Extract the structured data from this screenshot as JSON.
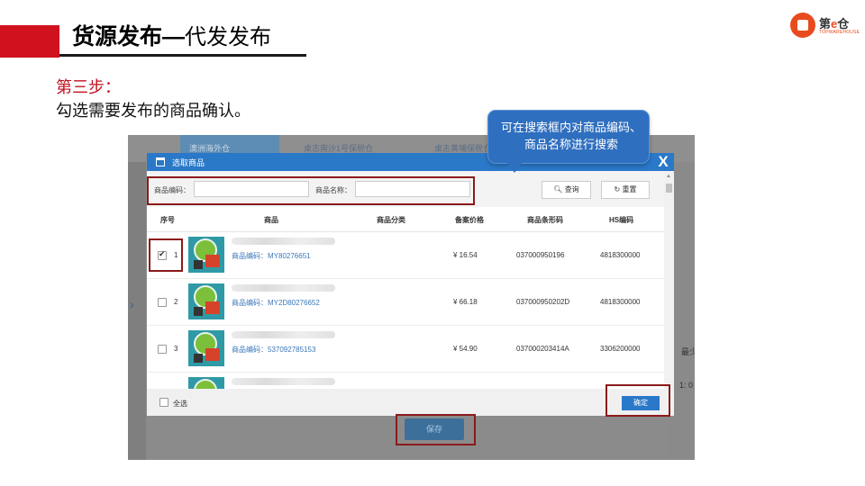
{
  "slide": {
    "title_main": "货源发布—",
    "title_sub": "代发发布",
    "step_label": "第三步：",
    "step_desc": "勾选需要发布的商品确认。",
    "tooltip": "可在搜索框内对商品编码、商品名称进行搜索"
  },
  "logo": {
    "prefix": "第",
    "e": "e",
    "suffix": "仓",
    "sub": "TOPWAREHOUSE"
  },
  "background": {
    "tabs": [
      "澳洲海外仓",
      "桌志南沙1号保税仓",
      "桌志黄埔保税仓"
    ],
    "right_labels": [
      "最少",
      "1: 0"
    ]
  },
  "modal": {
    "title": "选取商品",
    "close": "X",
    "search": {
      "code_label": "商品编码：",
      "code_value": "",
      "name_label": "商品名称：",
      "name_value": "",
      "query_button": "查询",
      "reset_button": "重置"
    },
    "columns": [
      "序号",
      "商品",
      "商品分类",
      "备案价格",
      "商品条形码",
      "HS编码"
    ],
    "rows": [
      {
        "index": "1",
        "checked": true,
        "code": "商品编码：MY80276651",
        "price": "¥ 16.54",
        "barcode": "037000950196",
        "hs": "4818300000"
      },
      {
        "index": "2",
        "checked": false,
        "code": "商品编码：MY2D80276652",
        "price": "¥ 66.18",
        "barcode": "037000950202D",
        "hs": "4818300000"
      },
      {
        "index": "3",
        "checked": false,
        "code": "商品编码：537092785153",
        "price": "¥ 54.90",
        "barcode": "037000203414A",
        "hs": "3306200000"
      }
    ],
    "select_all": "全选",
    "confirm": "确定"
  },
  "save_button": "保存",
  "colors": {
    "accent_red": "#d0111e",
    "modal_blue": "#2a78c8",
    "highlight": "#8b1a1a"
  }
}
